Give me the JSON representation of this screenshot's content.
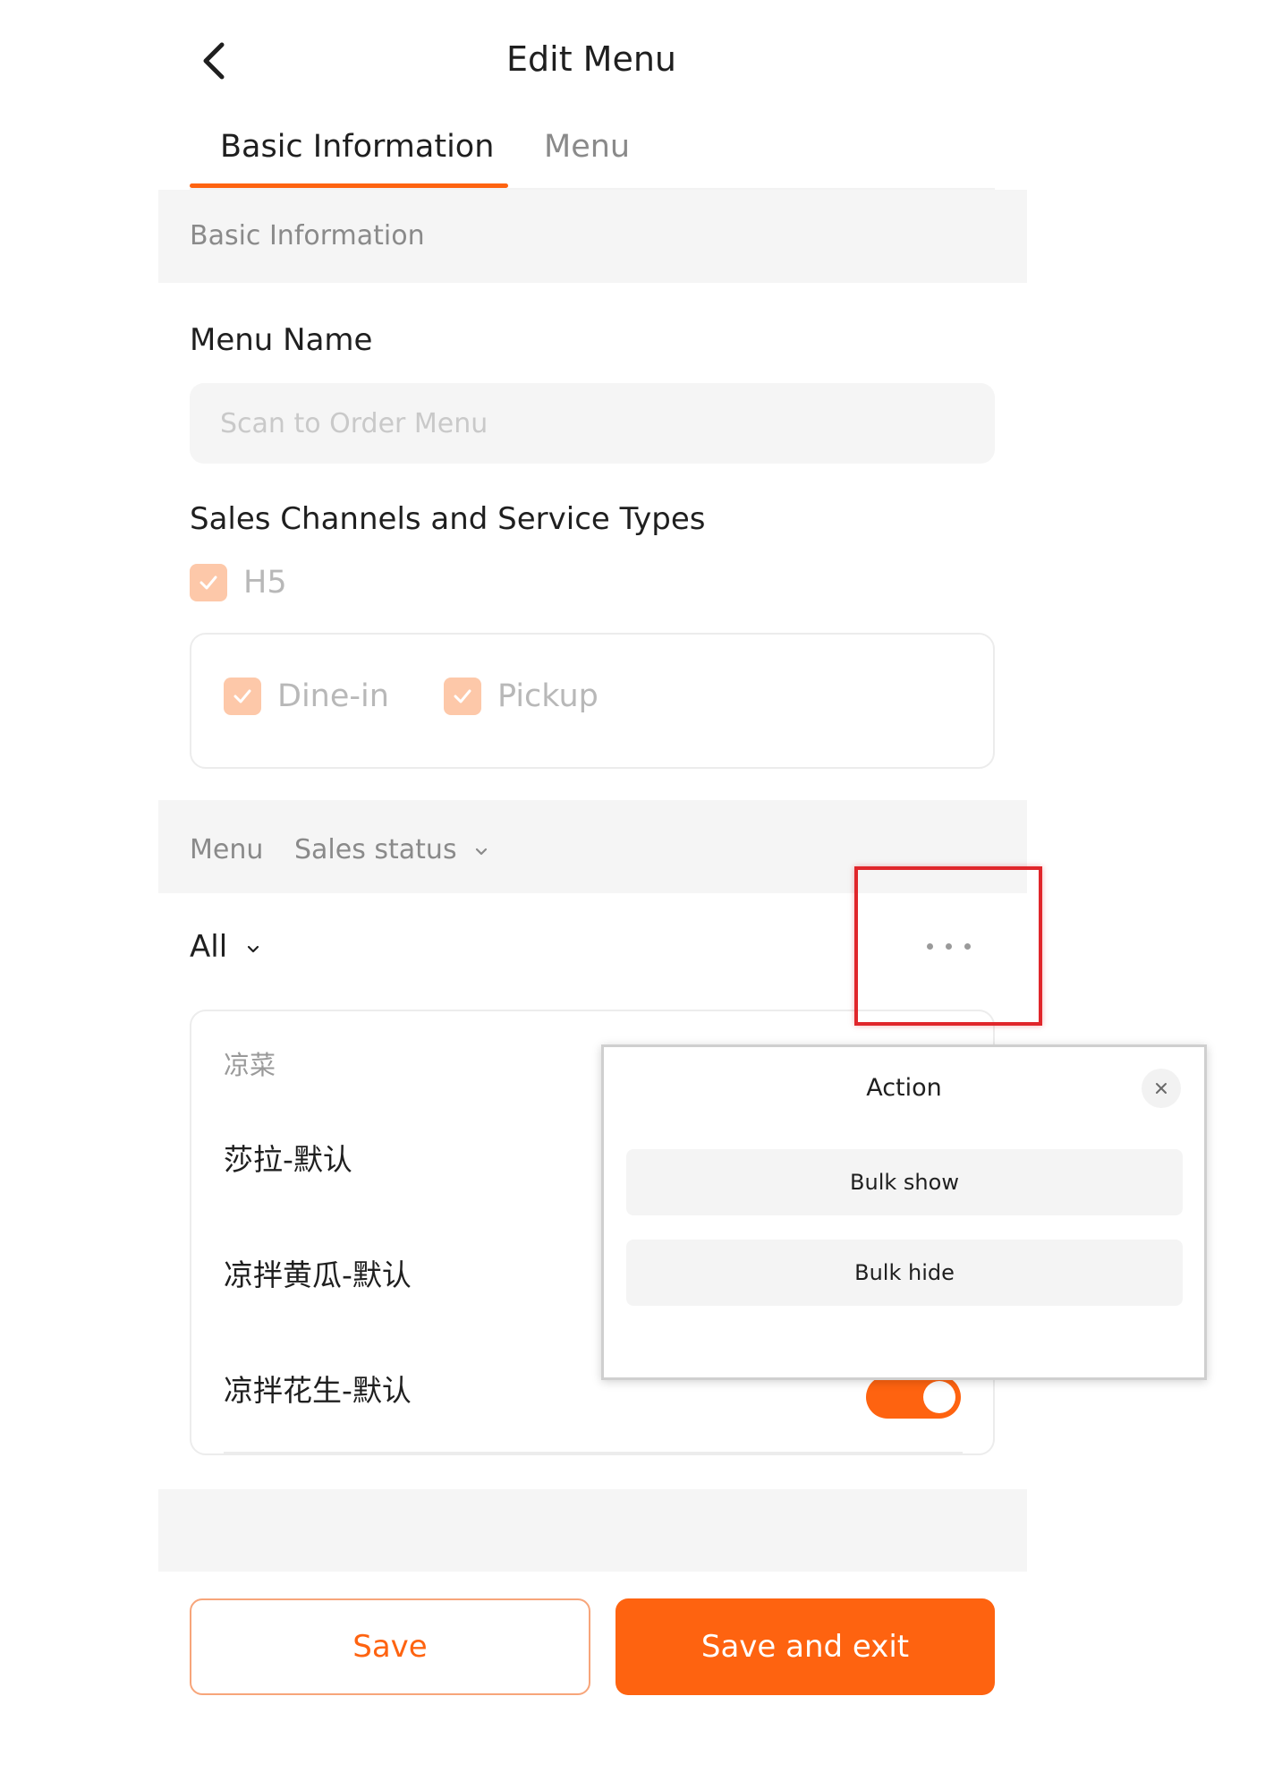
{
  "header": {
    "title": "Edit Menu",
    "back_icon": "chevron-left-icon"
  },
  "tabs": [
    {
      "label": "Basic Information",
      "active": true
    },
    {
      "label": "Menu",
      "active": false
    }
  ],
  "basic_section": {
    "header": "Basic Information",
    "menu_name_label": "Menu Name",
    "menu_name_placeholder": "Scan to Order Menu",
    "channels_label": "Sales Channels and Service Types",
    "channel": {
      "label": "H5",
      "checked": true
    },
    "service_types": [
      {
        "label": "Dine-in",
        "checked": true
      },
      {
        "label": "Pickup",
        "checked": true
      }
    ]
  },
  "menu_section": {
    "header_menu": "Menu",
    "header_sales_status": "Sales status",
    "filter_all": "All",
    "category": "凉菜",
    "items": [
      {
        "label": "莎拉-默认"
      },
      {
        "label": "凉拌黄瓜-默认"
      },
      {
        "label": "凉拌花生-默认",
        "toggle_on": true
      }
    ]
  },
  "action_popup": {
    "title": "Action",
    "bulk_show": "Bulk show",
    "bulk_hide": "Bulk hide"
  },
  "footer": {
    "save": "Save",
    "save_and_exit": "Save and exit"
  },
  "colors": {
    "accent": "#fe6310",
    "checkbox_disabled": "#fdc8a9",
    "highlight_border": "#e0262b",
    "band_bg": "#f5f5f5"
  }
}
